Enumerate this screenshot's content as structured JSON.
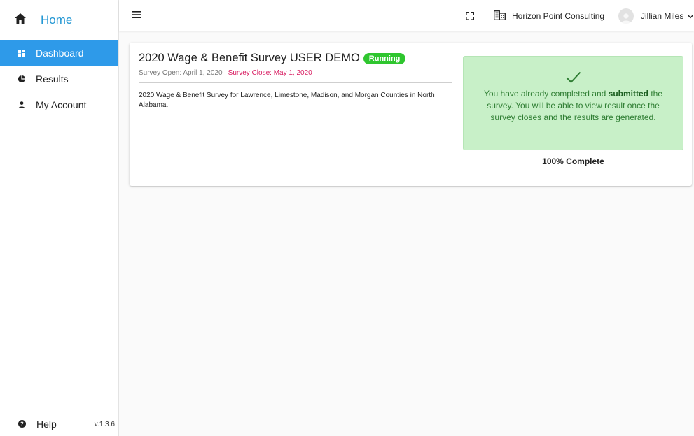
{
  "sidebar": {
    "home_label": "Home",
    "items": [
      {
        "label": "Dashboard",
        "icon": "dashboard-icon",
        "active": true
      },
      {
        "label": "Results",
        "icon": "pie-chart-icon",
        "active": false
      },
      {
        "label": "My Account",
        "icon": "person-icon",
        "active": false
      }
    ],
    "help_label": "Help",
    "version": "v.1.3.6"
  },
  "topbar": {
    "company": "Horizon Point Consulting",
    "user_name": "Jillian Miles"
  },
  "survey": {
    "title": "2020 Wage & Benefit Survey USER DEMO",
    "status_badge": "Running",
    "open_label": "Survey Open: April 1, 2020 | ",
    "close_label": "Survey Close: May 1, 2020",
    "description": "2020 Wage & Benefit Survey for Lawrence, Limestone, Madison, and Morgan Counties in North Alabama.",
    "status_message_before": "You have already completed and ",
    "status_message_bold": "submitted",
    "status_message_after": " the survey. You will be able to view result once the survey closes and the results are generated.",
    "progress_text": "100% Complete",
    "progress_fraction": 1.0
  },
  "colors": {
    "accent": "#2196d3",
    "active_nav": "#2e9ae9",
    "badge_green": "#2fc62f",
    "close_date": "#d81b60",
    "status_bg": "#c8f0c8",
    "status_text": "#2e7d32"
  }
}
